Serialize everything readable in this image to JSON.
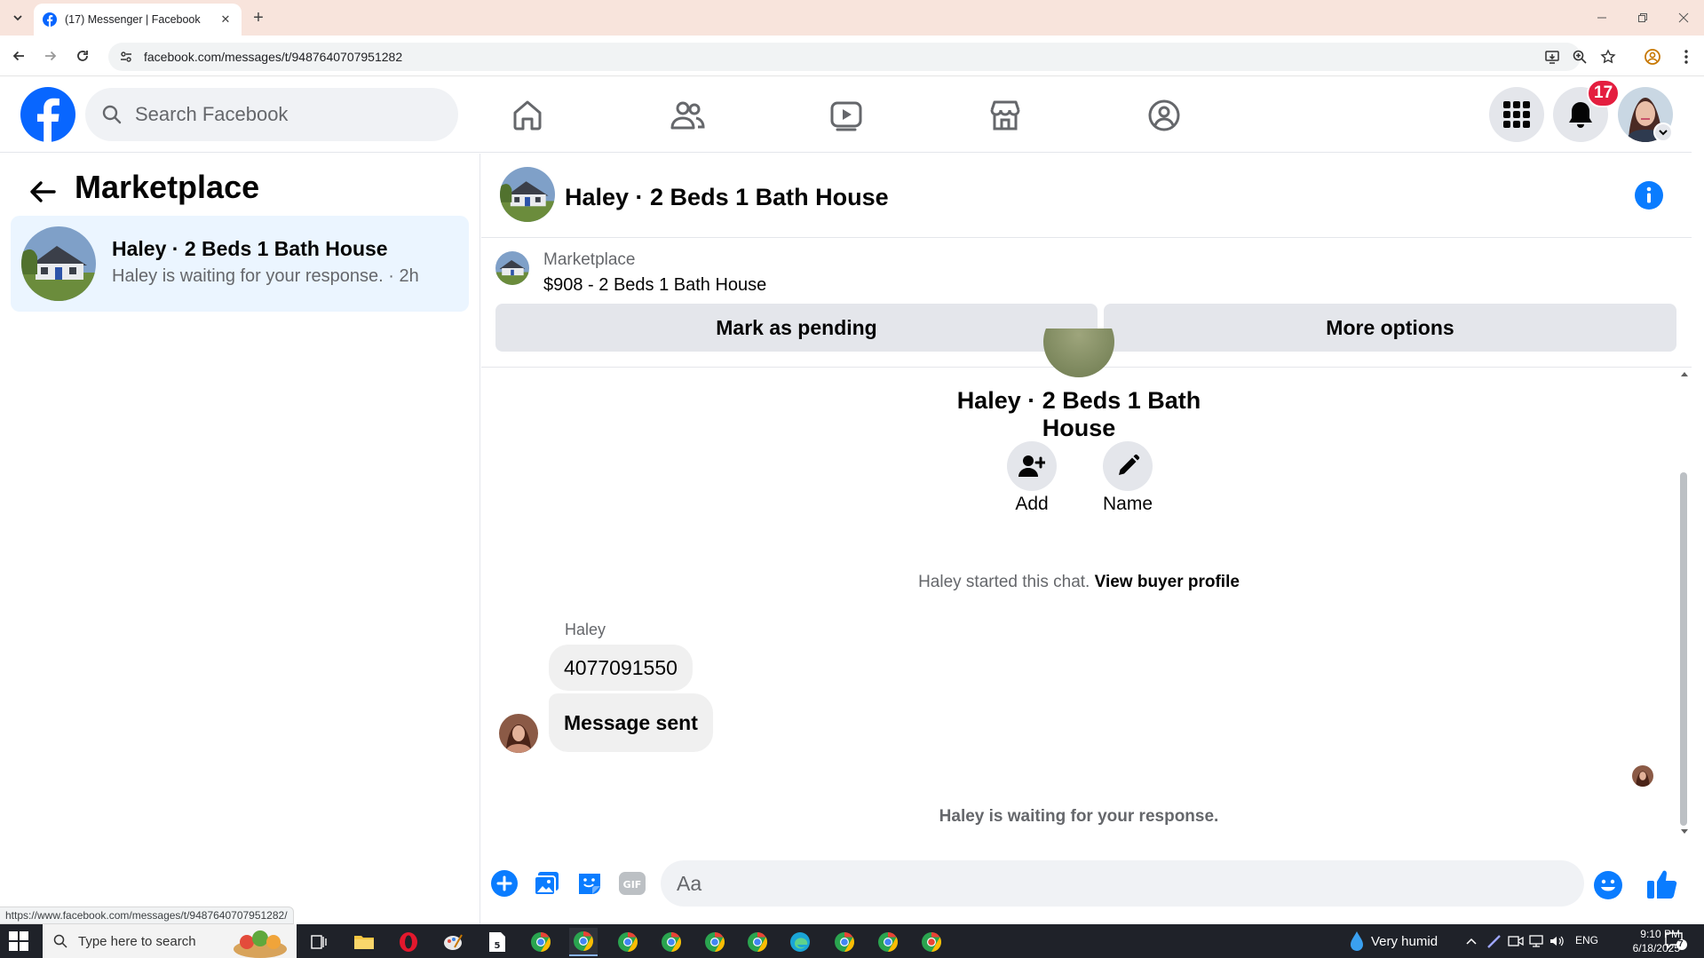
{
  "browser": {
    "tab_title": "(17) Messenger | Facebook",
    "url": "facebook.com/messages/t/9487640707951282",
    "status_url": "https://www.facebook.com/messages/t/9487640707951282/"
  },
  "fb_header": {
    "search_placeholder": "Search Facebook",
    "notification_count": "17"
  },
  "sidebar": {
    "title": "Marketplace",
    "chat": {
      "name": "Haley · 2 Beds 1 Bath House",
      "preview": "Haley is waiting for your response. · 2h"
    }
  },
  "conversation": {
    "title": "Haley · 2 Beds 1 Bath House",
    "listing_label": "Marketplace",
    "listing_price": "$908 - 2 Beds 1 Bath House",
    "mark_pending_label": "Mark as pending",
    "more_options_label": "More options",
    "center_title": "Haley · 2 Beds 1 Bath House",
    "add_label": "Add",
    "name_label": "Name",
    "started_text": "Haley started this chat.",
    "view_profile_label": "View buyer profile",
    "sender_name": "Haley",
    "messages": [
      "4077091550",
      "Message sent"
    ],
    "waiting_text": "Haley is waiting for your response.",
    "composer_placeholder": "Aa"
  },
  "taskbar": {
    "search_placeholder": "Type here to search",
    "weather": "Very humid",
    "language": "ENG",
    "time": "9:10 PM",
    "date": "6/18/2025",
    "notification_count": "7"
  },
  "colors": {
    "fb_blue": "#0866ff",
    "messenger_blue": "#0a7cff",
    "badge_red": "#e41e3f",
    "selected_chat_bg": "#ebf5ff",
    "tab_strip": "#f8e4dc"
  }
}
